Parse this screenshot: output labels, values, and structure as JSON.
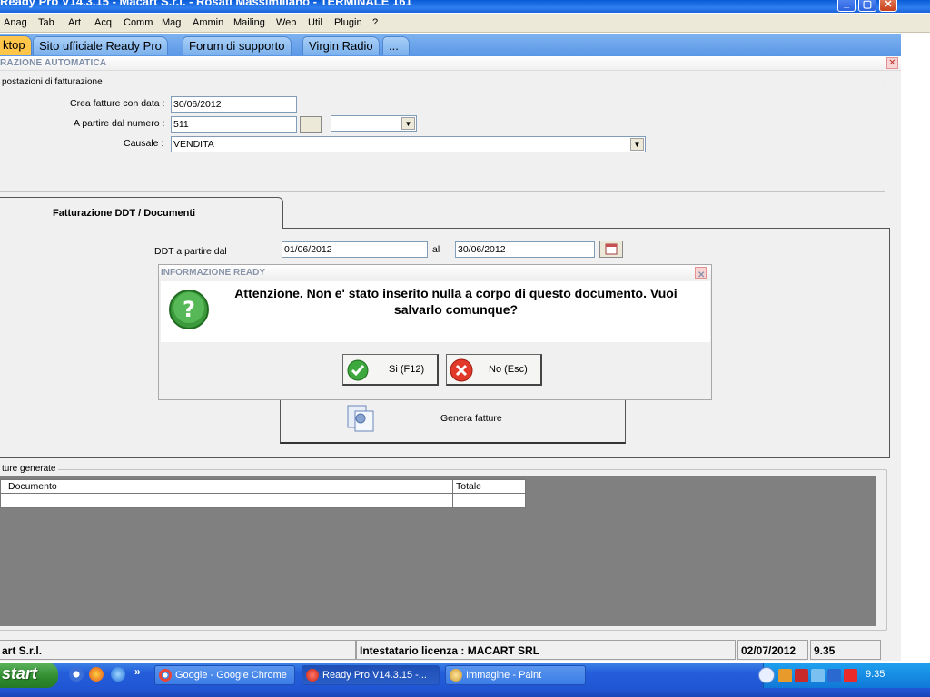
{
  "window": {
    "title": "Ready Pro V14.3.15 - Macart S.r.l. - Rosati Massimiliano - TERMINALE 161"
  },
  "menu": [
    "Anag",
    "Tab",
    "Art",
    "Acq",
    "Comm",
    "Mag",
    "Ammin",
    "Mailing",
    "Web",
    "Util",
    "Plugin",
    "?"
  ],
  "tabs": [
    "ktop",
    "Sito ufficiale Ready Pro",
    "Forum di supporto",
    "Virgin Radio",
    "..."
  ],
  "panel": {
    "title": "RAZIONE AUTOMATICA",
    "settings_group": "postazioni di fatturazione",
    "fields": {
      "data_label": "Crea fatture con data :",
      "data_value": "30/06/2012",
      "numero_label": "A partire dal numero :",
      "numero_value": "511",
      "causale_label": "Causale :",
      "causale_value": "VENDITA"
    },
    "ddt_tab": "Fatturazione DDT / Documenti",
    "ddt_from_label": "DDT a partire dal",
    "ddt_from": "01/06/2012",
    "ddt_to_label": "al",
    "ddt_to": "30/06/2012",
    "generate_label": "Genera fatture",
    "generated_group": "ture generate",
    "columns": [
      "Documento",
      "Totale"
    ]
  },
  "dialog": {
    "title": "INFORMAZIONE READY",
    "message": "Attenzione. Non e' stato inserito nulla a corpo di questo documento. Vuoi salvarlo comunque?",
    "yes_label": "Si (F12)",
    "no_label": "No (Esc)"
  },
  "status": {
    "company": "art S.r.l.",
    "license": "Intestatario licenza : MACART SRL",
    "date": "02/07/2012",
    "time": "9.35"
  },
  "taskbar": {
    "start": "start",
    "items": [
      "Google - Google Chrome",
      "Ready Pro V14.3.15 -...",
      "Immagine - Paint"
    ],
    "clock": "9.35",
    "more": "»"
  },
  "colors": {
    "titlebar": "#0a5bd6",
    "tabbar": "#7fb3f0",
    "active_tab": "#ffc64a",
    "taskbar": "#245edb",
    "start": "#2e8b2e"
  }
}
